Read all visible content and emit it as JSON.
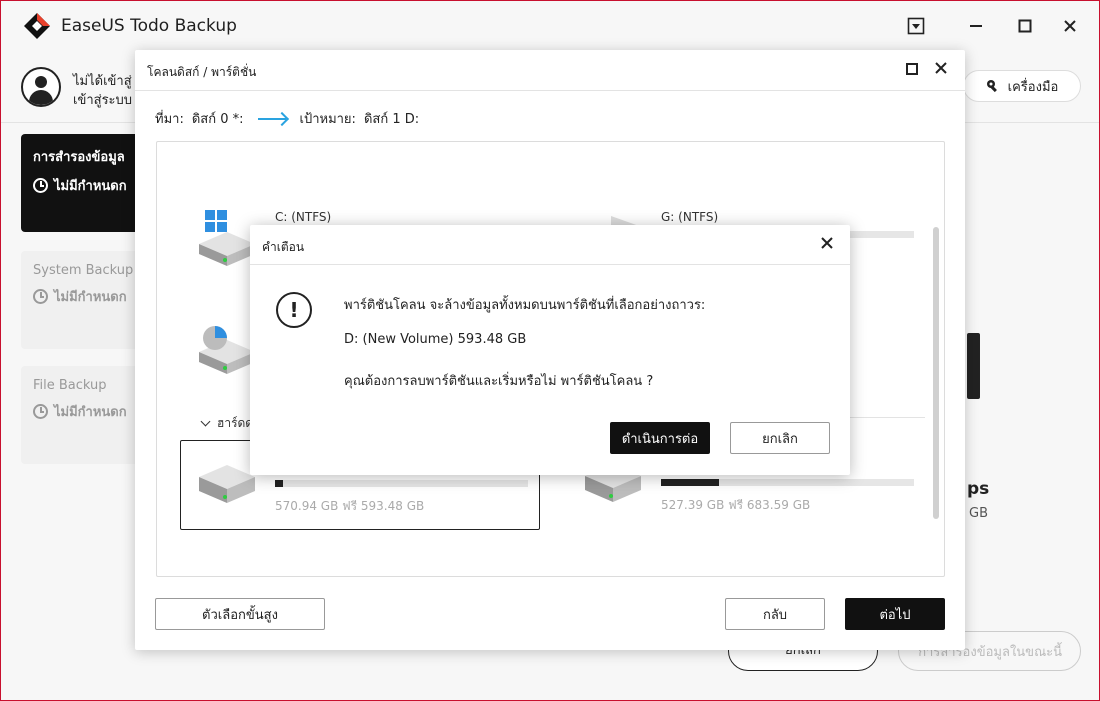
{
  "app": {
    "title": "EaseUS Todo Backup",
    "user_line1": "ไม่ได้เข้าสู่",
    "user_line2": "เข้าสู่ระบบ",
    "tools_label": "เครื่องมือ"
  },
  "sidebar": {
    "cards": [
      {
        "title": "การสำรองข้อมูล",
        "sub": "ไม่มีกำหนดก"
      },
      {
        "title": "System Backup",
        "sub": "ไม่มีกำหนดก"
      },
      {
        "title": "File Backup",
        "sub": "ไม่มีกำหนดก"
      }
    ]
  },
  "background": {
    "frag1": "ps",
    "frag2": "GB",
    "cancel_label": "ยกเลิก",
    "backup_now_label": "การสำรองข้อมูลในขณะนี้"
  },
  "clone_dialog": {
    "title": "โคลนดิสก์ / พาร์ติชั่น",
    "source_label": "ที่มา:",
    "source_value": "ดิสก์ 0 *:",
    "target_label": "เป้าหมาย:",
    "target_value": "ดิสก์ 1 D:",
    "section_label": "ฮาร์ดด",
    "partitions": [
      {
        "label": "C: (NTFS)",
        "size": "",
        "fill": 0
      },
      {
        "label": "G: (NTFS)",
        "size": "",
        "fill": 0
      },
      {
        "label": "",
        "size": "570.94 GB ฟรี 593.48 GB",
        "fill": 0.03
      },
      {
        "label": "",
        "size": "527.39 GB ฟรี 683.59 GB",
        "fill": 0.23
      }
    ],
    "advanced_label": "ตัวเลือกขั้นสูง",
    "back_label": "กลับ",
    "next_label": "ต่อไป"
  },
  "warning_dialog": {
    "title": "คำเตือน",
    "icon": "!",
    "line1": "พาร์ติชันโคลน จะล้างข้อมูลทั้งหมดบนพาร์ติชันที่เลือกอย่างถาวร:",
    "line2": "D: (New Volume) 593.48 GB",
    "line3": "คุณต้องการลบพาร์ติชันและเริ่มหรือไม่ พาร์ติชันโคลน ?",
    "continue_label": "ดำเนินการต่อ",
    "cancel_label": "ยกเลิก"
  },
  "colors": {
    "accent_black": "#111111",
    "arrow_blue": "#2aa3e0",
    "window_border": "#c8102e"
  }
}
